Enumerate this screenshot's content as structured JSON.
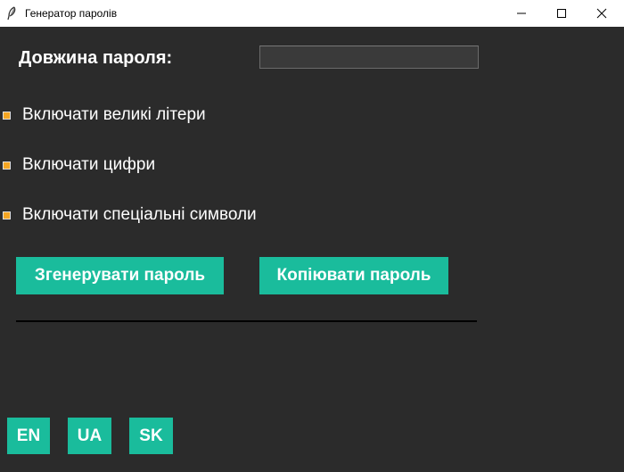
{
  "window": {
    "title": "Генератор паролів",
    "controls": [
      "minimize",
      "maximize",
      "close"
    ]
  },
  "form": {
    "length_label": "Довжина пароля:",
    "length_value": ""
  },
  "options": [
    {
      "label": "Включати великі літери",
      "checked": true
    },
    {
      "label": "Включати цифри",
      "checked": true
    },
    {
      "label": "Включати спеціальні символи",
      "checked": true
    }
  ],
  "buttons": {
    "generate": "Згенерувати пароль",
    "copy": "Копіювати пароль"
  },
  "languages": [
    "EN",
    "UA",
    "SK"
  ],
  "colors": {
    "background": "#2b2b2b",
    "accent": "#1abc9c",
    "checkbox": "#f5a623",
    "text": "#ffffff"
  }
}
